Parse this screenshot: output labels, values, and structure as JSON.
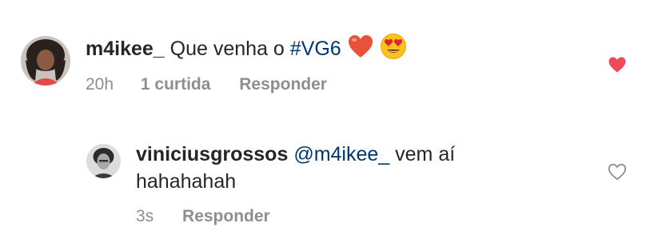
{
  "comment": {
    "username": "m4ikee_",
    "text_before": "Que venha o",
    "hashtag": "#VG6",
    "emojis": [
      "red-heart-emoji",
      "heart-eyes-emoji"
    ],
    "time": "20h",
    "likes": "1 curtida",
    "reply_label": "Responder",
    "liked": true,
    "like_color": "#ed4956"
  },
  "reply": {
    "username": "viniciusgrossos",
    "mention": "@m4ikee_",
    "text_after": "vem aí",
    "text_line2": "hahahahah",
    "time": "3s",
    "reply_label": "Responder",
    "liked": false
  }
}
